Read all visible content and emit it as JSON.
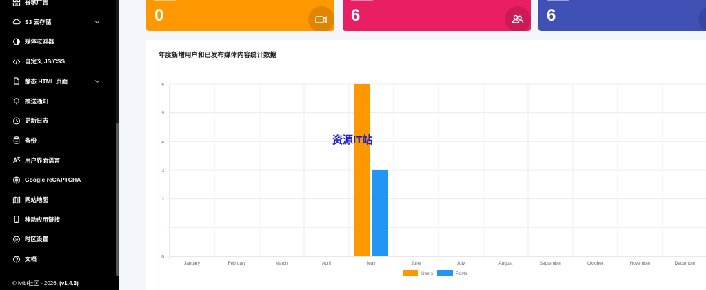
{
  "sidebar": {
    "items": [
      {
        "label": "谷歌广告",
        "icon": "ads-grid-icon",
        "chevron": false
      },
      {
        "label": "S3 云存储",
        "icon": "cloud-icon",
        "chevron": true
      },
      {
        "label": "媒体过滤器",
        "icon": "filter-icon",
        "chevron": false
      },
      {
        "label": "自定义 JS/CSS",
        "icon": "code-icon",
        "chevron": false
      },
      {
        "label": "静态 HTML 页面",
        "icon": "file-icon",
        "chevron": true
      },
      {
        "label": "推送通知",
        "icon": "bell-icon",
        "chevron": false
      },
      {
        "label": "更新日志",
        "icon": "history-icon",
        "chevron": false
      },
      {
        "label": "备份",
        "icon": "database-icon",
        "chevron": false
      },
      {
        "label": "用户界面语言",
        "icon": "translate-icon",
        "chevron": false
      },
      {
        "label": "Google reCAPTCHA",
        "icon": "recaptcha-icon",
        "chevron": false
      },
      {
        "label": "网站地图",
        "icon": "map-icon",
        "chevron": false
      },
      {
        "label": "移动应用链接",
        "icon": "mobile-icon",
        "chevron": false
      },
      {
        "label": "时区设置",
        "icon": "timezone-icon",
        "chevron": false
      },
      {
        "label": "文档",
        "icon": "help-icon",
        "chevron": false
      }
    ],
    "footer_prefix": "© lvtbt社区 - 2026.",
    "footer_version": "(v1.4.3)"
  },
  "cards": [
    {
      "value": "0",
      "color": "#ff9800",
      "icon": "video-icon"
    },
    {
      "value": "6",
      "color": "#e91e63",
      "icon": "users-icon"
    },
    {
      "value": "6",
      "color": "#3f51b5",
      "icon": "stats-icon"
    }
  ],
  "panel": {
    "title": "年度新增用户和已发布媒体内容统计数据",
    "watermark": "资源IT站"
  },
  "chart_data": {
    "type": "bar",
    "title": "年度新增用户和已发布媒体内容统计数据",
    "categories": [
      "January",
      "February",
      "March",
      "April",
      "May",
      "June",
      "July",
      "August",
      "September",
      "October",
      "November",
      "December"
    ],
    "series": [
      {
        "name": "Users",
        "color": "#ff9800",
        "values": [
          0,
          0,
          0,
          0,
          6,
          0,
          0,
          0,
          0,
          0,
          0,
          0
        ]
      },
      {
        "name": "Posts",
        "color": "#2196f3",
        "values": [
          0,
          0,
          0,
          0,
          3,
          0,
          0,
          0,
          0,
          0,
          0,
          0
        ]
      }
    ],
    "yticks": [
      0,
      1,
      2,
      3,
      4,
      5,
      6
    ],
    "ylim": [
      0,
      6
    ],
    "legend": "bottom",
    "grid": true
  }
}
